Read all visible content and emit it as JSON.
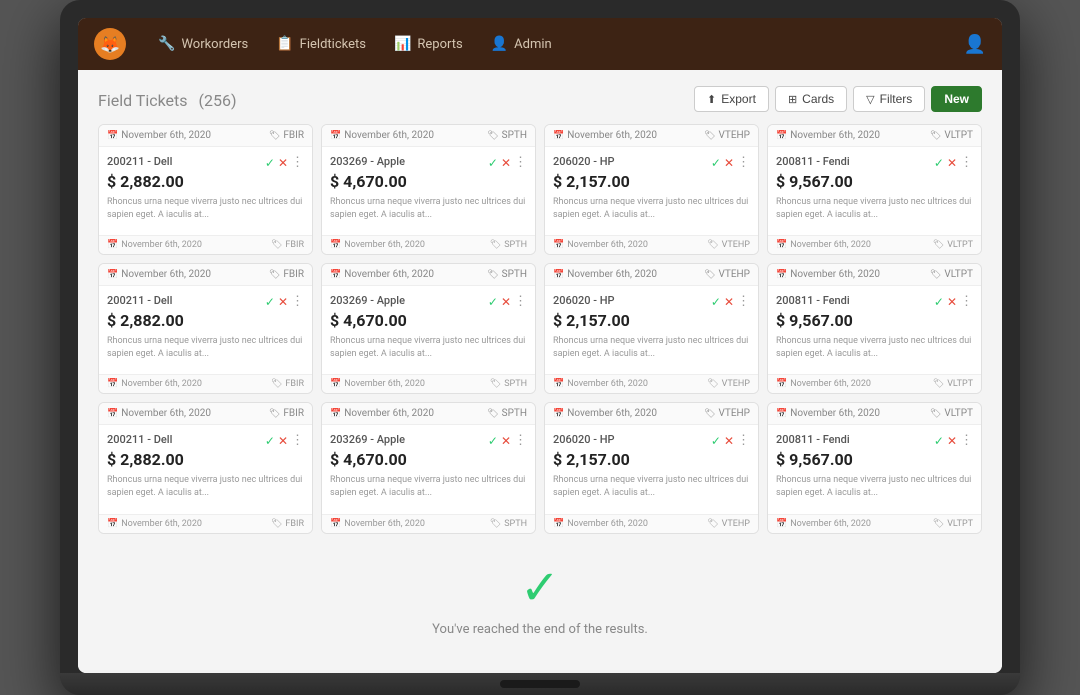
{
  "nav": {
    "logo": "🦊",
    "items": [
      {
        "id": "workorders",
        "icon": "🔧",
        "label": "Workorders"
      },
      {
        "id": "fieldtickets",
        "icon": "📋",
        "label": "Fieldtickets"
      },
      {
        "id": "reports",
        "icon": "📊",
        "label": "Reports"
      },
      {
        "id": "admin",
        "icon": "👤",
        "label": "Admin"
      }
    ],
    "user_icon": "👤"
  },
  "page": {
    "title": "Field Tickets",
    "count": "(256)",
    "buttons": {
      "export": "Export",
      "cards": "Cards",
      "filters": "Filters",
      "new": "New"
    }
  },
  "cards": [
    {
      "date": "November 6th, 2020",
      "tag": "FBIR",
      "title": "200211 - Dell",
      "amount": "$ 2,882.00",
      "desc": "Rhoncus urna neque viverra justo nec ultrices dui sapien eget. A iaculis at...",
      "footer_date": "November 6th, 2020",
      "footer_tag": "FBIR"
    },
    {
      "date": "November 6th, 2020",
      "tag": "SPTH",
      "title": "203269 - Apple",
      "amount": "$ 4,670.00",
      "desc": "Rhoncus urna neque viverra justo nec ultrices dui sapien eget. A iaculis at...",
      "footer_date": "November 6th, 2020",
      "footer_tag": "SPTH"
    },
    {
      "date": "November 6th, 2020",
      "tag": "VTEHP",
      "title": "206020 - HP",
      "amount": "$ 2,157.00",
      "desc": "Rhoncus urna neque viverra justo nec ultrices dui sapien eget. A iaculis at...",
      "footer_date": "November 6th, 2020",
      "footer_tag": "VTEHP"
    },
    {
      "date": "November 6th, 2020",
      "tag": "VLTPT",
      "title": "200811 - Fendi",
      "amount": "$ 9,567.00",
      "desc": "Rhoncus urna neque viverra justo nec ultrices dui sapien eget. A iaculis at...",
      "footer_date": "November 6th, 2020",
      "footer_tag": "VLTPT"
    },
    {
      "date": "November 6th, 2020",
      "tag": "FBIR",
      "title": "200211 - Dell",
      "amount": "$ 2,882.00",
      "desc": "Rhoncus urna neque viverra justo nec ultrices dui sapien eget. A iaculis at...",
      "footer_date": "November 6th, 2020",
      "footer_tag": "FBIR"
    },
    {
      "date": "November 6th, 2020",
      "tag": "SPTH",
      "title": "203269 - Apple",
      "amount": "$ 4,670.00",
      "desc": "Rhoncus urna neque viverra justo nec ultrices dui sapien eget. A iaculis at...",
      "footer_date": "November 6th, 2020",
      "footer_tag": "SPTH"
    },
    {
      "date": "November 6th, 2020",
      "tag": "VTEHP",
      "title": "206020 - HP",
      "amount": "$ 2,157.00",
      "desc": "Rhoncus urna neque viverra justo nec ultrices dui sapien eget. A iaculis at...",
      "footer_date": "November 6th, 2020",
      "footer_tag": "VTEHP"
    },
    {
      "date": "November 6th, 2020",
      "tag": "VLTPT",
      "title": "200811 - Fendi",
      "amount": "$ 9,567.00",
      "desc": "Rhoncus urna neque viverra justo nec ultrices dui sapien eget. A iaculis at...",
      "footer_date": "November 6th, 2020",
      "footer_tag": "VLTPT"
    },
    {
      "date": "November 6th, 2020",
      "tag": "FBIR",
      "title": "200211 - Dell",
      "amount": "$ 2,882.00",
      "desc": "Rhoncus urna neque viverra justo nec ultrices dui sapien eget. A iaculis at...",
      "footer_date": "November 6th, 2020",
      "footer_tag": "FBIR"
    },
    {
      "date": "November 6th, 2020",
      "tag": "SPTH",
      "title": "203269 - Apple",
      "amount": "$ 4,670.00",
      "desc": "Rhoncus urna neque viverra justo nec ultrices dui sapien eget. A iaculis at...",
      "footer_date": "November 6th, 2020",
      "footer_tag": "SPTH"
    },
    {
      "date": "November 6th, 2020",
      "tag": "VTEHP",
      "title": "206020 - HP",
      "amount": "$ 2,157.00",
      "desc": "Rhoncus urna neque viverra justo nec ultrices dui sapien eget. A iaculis at...",
      "footer_date": "November 6th, 2020",
      "footer_tag": "VTEHP"
    },
    {
      "date": "November 6th, 2020",
      "tag": "VLTPT",
      "title": "200811 - Fendi",
      "amount": "$ 9,567.00",
      "desc": "Rhoncus urna neque viverra justo nec ultrices dui sapien eget. A iaculis at...",
      "footer_date": "November 6th, 2020",
      "footer_tag": "VLTPT"
    }
  ],
  "end": {
    "check": "✓",
    "message": "You've reached the end of the results."
  }
}
